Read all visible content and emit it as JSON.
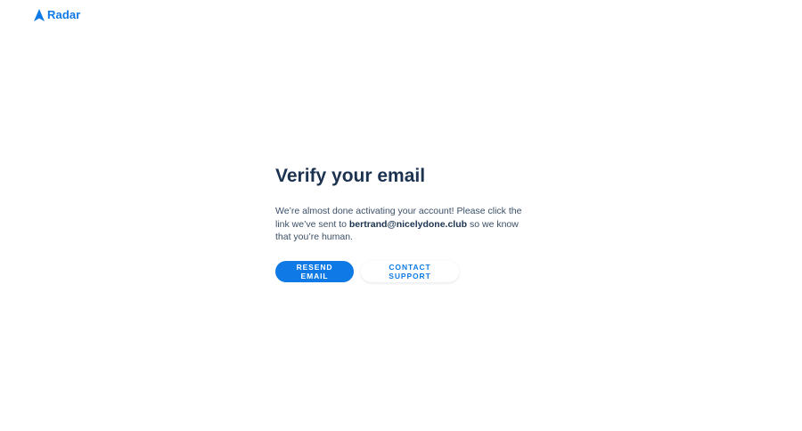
{
  "brand": {
    "name": "Radar",
    "color": "#0f7ae5",
    "icon": "radar-logo-icon"
  },
  "verify": {
    "title": "Verify your email",
    "message_before": "We’re almost done activating your account! Please click the link we’ve sent to ",
    "email": "bertrand@nicelydone.club",
    "message_after": " so we know that you’re human."
  },
  "actions": {
    "resend_label": "RESEND EMAIL",
    "support_label": "CONTACT SUPPORT"
  }
}
